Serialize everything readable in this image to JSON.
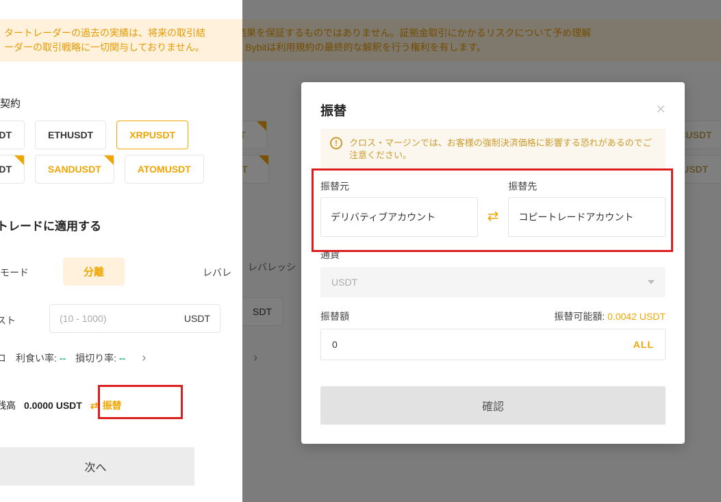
{
  "banners": {
    "bg_line1": "タートレーダーの過去の実績は、将来の取引結の取引結果を保証するものではありません。証拠金取引にかかるリスクについて予め理解",
    "bg_line2": "ーダーの取引戦略に一切関与しておりません。ません。Bybitは利用規約の最終的な解釈を行う権利を有します。",
    "lp_line1": "タートレーダーの過去の実績は、将来の取引結",
    "lp_line2": "ーダーの取引戦略に一切関与しておりません。"
  },
  "bg": {
    "pills_r1_3": "RPUSDT",
    "pills_r2_3": "OMUSDT",
    "right_stub_1": "TICUSDT",
    "right_stub_2": "TTUSDT",
    "lev_label": "レバレッシ",
    "usdt_pill": "SDT"
  },
  "left": {
    "contract_label": "契約",
    "pills_r1": [
      "SDT",
      "ETHUSDT",
      "XRPUSDT"
    ],
    "pills_r2": [
      "SDT",
      "SANDUSDT",
      "ATOMUSDT"
    ],
    "section_title": "トレードに適用する",
    "mode_label": "ンモード",
    "mode_value": "分離",
    "lev_label": "レバレ",
    "cost_label": "スト",
    "cost_placeholder": "(10 - 1000)",
    "cost_unit": "USDT",
    "rate_prefix": "コ",
    "profit_label": "利食い率:",
    "loss_label": "損切り率:",
    "dash": "--",
    "balance_label": "残高",
    "balance_value": "0.0000 USDT",
    "transfer_label": "振替",
    "next_label": "次へ"
  },
  "modal": {
    "title": "振替",
    "warning": "クロス・マージンでは、お客様の強制決済価格に影響する恐れがあるのでご注意ください。",
    "from_label": "振替元",
    "to_label": "振替先",
    "from_account": "デリバティブアカウント",
    "to_account": "コピートレードアカウント",
    "currency_label": "通貨",
    "currency_value": "USDT",
    "amount_label": "振替額",
    "available_label": "振替可能額:",
    "available_value": "0.0042 USDT",
    "amount_value": "0",
    "all_label": "ALL",
    "confirm_label": "確認"
  }
}
